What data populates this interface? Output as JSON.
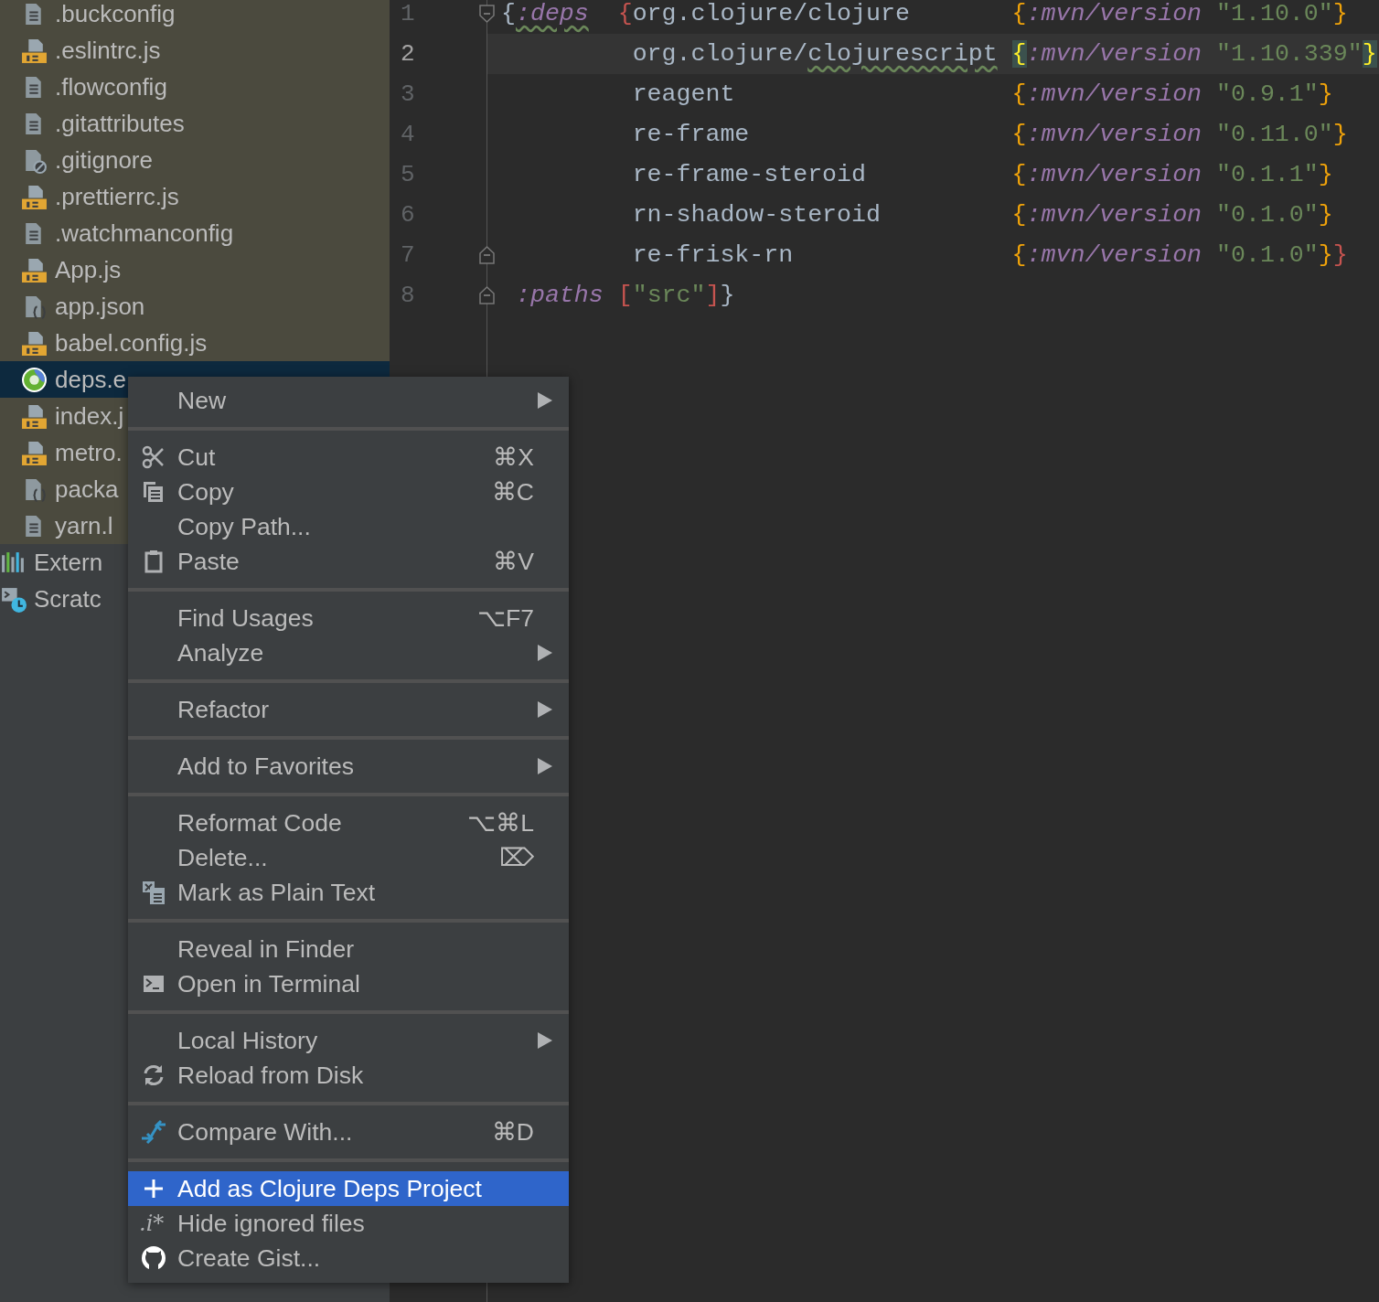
{
  "sidebar": {
    "items": [
      {
        "label": ".buckconfig",
        "kind": "text-file",
        "selected": false
      },
      {
        "label": ".eslintrc.js",
        "kind": "js-file",
        "selected": false
      },
      {
        "label": ".flowconfig",
        "kind": "text-file",
        "selected": false
      },
      {
        "label": ".gitattributes",
        "kind": "text-file",
        "selected": false
      },
      {
        "label": ".gitignore",
        "kind": "ignore-file",
        "selected": false
      },
      {
        "label": ".prettierrc.js",
        "kind": "js-file",
        "selected": false
      },
      {
        "label": ".watchmanconfig",
        "kind": "text-file",
        "selected": false
      },
      {
        "label": "App.js",
        "kind": "js-file",
        "selected": false
      },
      {
        "label": "app.json",
        "kind": "json-file",
        "selected": false
      },
      {
        "label": "babel.config.js",
        "kind": "js-file",
        "selected": false
      },
      {
        "label": "deps.e",
        "kind": "clojure-file",
        "selected": true
      },
      {
        "label": "index.j",
        "kind": "js-file",
        "selected": false
      },
      {
        "label": "metro.",
        "kind": "js-file",
        "selected": false
      },
      {
        "label": "packa",
        "kind": "json-file",
        "selected": false
      },
      {
        "label": "yarn.l",
        "kind": "text-file",
        "selected": false
      },
      {
        "label": "Extern",
        "kind": "libraries",
        "selected": false
      },
      {
        "label": "Scratc",
        "kind": "scratches",
        "selected": false
      }
    ]
  },
  "editor": {
    "lines": [
      {
        "number": "1",
        "current": false,
        "fold_start": true,
        "fold_end": false,
        "tokens": [
          {
            "kind": "punct",
            "text": "{"
          },
          {
            "kind": "keyword-warn",
            "text": ":deps"
          },
          {
            "kind": "brace-red",
            "text": "  {"
          },
          {
            "kind": "symbol",
            "text": "org.clojure/clojure"
          },
          {
            "kind": "brace-orange",
            "text": "       {"
          },
          {
            "kind": "keyword",
            "text": ":mvn/version"
          },
          {
            "kind": "string",
            "text": " \"1.10.0\""
          },
          {
            "kind": "brace-orange",
            "text": "}"
          }
        ]
      },
      {
        "number": "2",
        "current": true,
        "fold_start": false,
        "fold_end": false,
        "tokens": [
          {
            "kind": "symbol",
            "text": "         org.clojure/"
          },
          {
            "kind": "symbol-warn",
            "text": "clojurescript"
          },
          {
            "kind": "brace-match",
            "text": " {"
          },
          {
            "kind": "keyword",
            "text": ":mvn/version"
          },
          {
            "kind": "string",
            "text": " \"1.10.339\""
          },
          {
            "kind": "brace-match",
            "text": "}"
          }
        ]
      },
      {
        "number": "3",
        "current": false,
        "fold_start": false,
        "fold_end": false,
        "tokens": [
          {
            "kind": "symbol",
            "text": "         reagent"
          },
          {
            "kind": "brace-orange",
            "text": "                   {"
          },
          {
            "kind": "keyword",
            "text": ":mvn/version"
          },
          {
            "kind": "string",
            "text": " \"0.9.1\""
          },
          {
            "kind": "brace-orange",
            "text": "}"
          }
        ]
      },
      {
        "number": "4",
        "current": false,
        "fold_start": false,
        "fold_end": false,
        "tokens": [
          {
            "kind": "symbol",
            "text": "         re-frame"
          },
          {
            "kind": "brace-orange",
            "text": "                  {"
          },
          {
            "kind": "keyword",
            "text": ":mvn/version"
          },
          {
            "kind": "string",
            "text": " \"0.11.0\""
          },
          {
            "kind": "brace-orange",
            "text": "}"
          }
        ]
      },
      {
        "number": "5",
        "current": false,
        "fold_start": false,
        "fold_end": false,
        "tokens": [
          {
            "kind": "symbol",
            "text": "         re-frame-steroid"
          },
          {
            "kind": "brace-orange",
            "text": "          {"
          },
          {
            "kind": "keyword",
            "text": ":mvn/version"
          },
          {
            "kind": "string",
            "text": " \"0.1.1\""
          },
          {
            "kind": "brace-orange",
            "text": "}"
          }
        ]
      },
      {
        "number": "6",
        "current": false,
        "fold_start": false,
        "fold_end": false,
        "tokens": [
          {
            "kind": "symbol",
            "text": "         rn-shadow-steroid"
          },
          {
            "kind": "brace-orange",
            "text": "         {"
          },
          {
            "kind": "keyword",
            "text": ":mvn/version"
          },
          {
            "kind": "string",
            "text": " \"0.1.0\""
          },
          {
            "kind": "brace-orange",
            "text": "}"
          }
        ]
      },
      {
        "number": "7",
        "current": false,
        "fold_start": false,
        "fold_end": true,
        "tokens": [
          {
            "kind": "symbol",
            "text": "         re-frisk-rn"
          },
          {
            "kind": "brace-orange",
            "text": "               {"
          },
          {
            "kind": "keyword",
            "text": ":mvn/version"
          },
          {
            "kind": "string",
            "text": " \"0.1.0\""
          },
          {
            "kind": "brace-orange",
            "text": "}"
          },
          {
            "kind": "brace-red",
            "text": "}"
          }
        ]
      },
      {
        "number": "8",
        "current": false,
        "fold_start": false,
        "fold_end": true,
        "tokens": [
          {
            "kind": "keyword",
            "text": " :paths"
          },
          {
            "kind": "brace-red",
            "text": " ["
          },
          {
            "kind": "string",
            "text": "\"src\""
          },
          {
            "kind": "brace-red",
            "text": "]"
          },
          {
            "kind": "punct",
            "text": "}"
          }
        ]
      }
    ]
  },
  "context_menu": {
    "groups": [
      {
        "items": [
          {
            "label": "New",
            "kind": "plain",
            "submenu": true,
            "selected": false
          }
        ]
      },
      {
        "items": [
          {
            "label": "Cut",
            "kind": "scissors",
            "shortcut": "⌘X",
            "submenu": false,
            "selected": false
          },
          {
            "label": "Copy",
            "kind": "copy",
            "shortcut": "⌘C",
            "submenu": false,
            "selected": false
          },
          {
            "label": "Copy Path...",
            "kind": "plain",
            "submenu": false,
            "selected": false
          },
          {
            "label": "Paste",
            "kind": "clipboard",
            "shortcut": "⌘V",
            "submenu": false,
            "selected": false
          }
        ]
      },
      {
        "items": [
          {
            "label": "Find Usages",
            "kind": "plain",
            "shortcut": "⌥F7",
            "submenu": false,
            "selected": false
          },
          {
            "label": "Analyze",
            "kind": "plain",
            "submenu": true,
            "selected": false
          }
        ]
      },
      {
        "items": [
          {
            "label": "Refactor",
            "kind": "plain",
            "submenu": true,
            "selected": false
          }
        ]
      },
      {
        "items": [
          {
            "label": "Add to Favorites",
            "kind": "plain",
            "submenu": true,
            "selected": false
          }
        ]
      },
      {
        "items": [
          {
            "label": "Reformat Code",
            "kind": "plain",
            "shortcut": "⌥⌘L",
            "submenu": false,
            "selected": false
          },
          {
            "label": "Delete...",
            "kind": "plain",
            "shortcut": "⌦",
            "submenu": false,
            "selected": false
          },
          {
            "label": "Mark as Plain Text",
            "kind": "plain-text",
            "submenu": false,
            "selected": false
          }
        ]
      },
      {
        "items": [
          {
            "label": "Reveal in Finder",
            "kind": "plain",
            "submenu": false,
            "selected": false
          },
          {
            "label": "Open in Terminal",
            "kind": "terminal",
            "submenu": false,
            "selected": false
          }
        ]
      },
      {
        "items": [
          {
            "label": "Local History",
            "kind": "plain",
            "submenu": true,
            "selected": false
          },
          {
            "label": "Reload from Disk",
            "kind": "reload",
            "submenu": false,
            "selected": false
          }
        ]
      },
      {
        "items": [
          {
            "label": "Compare With...",
            "kind": "compare",
            "shortcut": "⌘D",
            "submenu": false,
            "selected": false
          }
        ]
      },
      {
        "items": [
          {
            "label": "Add as Clojure Deps Project",
            "kind": "plus",
            "submenu": false,
            "selected": true
          },
          {
            "label": "Hide ignored files",
            "kind": "text",
            "icon_text": ".i*",
            "submenu": false,
            "selected": false
          },
          {
            "label": "Create Gist...",
            "kind": "github",
            "submenu": false,
            "selected": false
          }
        ]
      }
    ]
  }
}
